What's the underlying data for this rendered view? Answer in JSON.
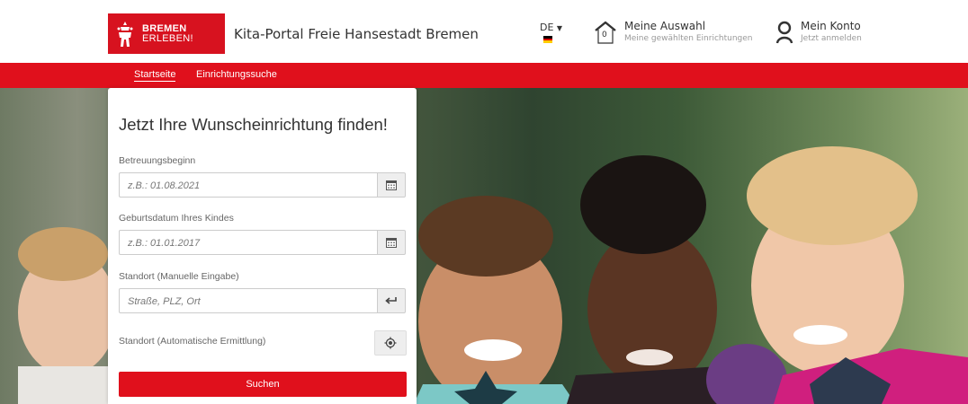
{
  "header": {
    "logo_line1": "BREMEN",
    "logo_line2": "ERLEBEN!",
    "portal_title": "Kita-Portal Freie Hansestadt Bremen",
    "language": "DE",
    "selection": {
      "title": "Meine Auswahl",
      "subtitle": "Meine gewählten Einrichtungen",
      "count": "0"
    },
    "account": {
      "title": "Mein Konto",
      "subtitle": "Jetzt anmelden"
    }
  },
  "nav": {
    "items": [
      {
        "label": "Startseite",
        "active": true
      },
      {
        "label": "Einrichtungssuche",
        "active": false
      }
    ]
  },
  "search": {
    "title": "Jetzt Ihre Wunscheinrichtung finden!",
    "start_label": "Betreuungsbeginn",
    "start_placeholder": "z.B.: 01.08.2021",
    "birth_label": "Geburtsdatum Ihres Kindes",
    "birth_placeholder": "z.B.: 01.01.2017",
    "location_label": "Standort (Manuelle Eingabe)",
    "location_placeholder": "Straße, PLZ, Ort",
    "auto_location_label": "Standort (Automatische Ermittlung)",
    "submit_label": "Suchen"
  },
  "colors": {
    "brand_red": "#e0101c",
    "logo_red": "#d7121f"
  },
  "icons": [
    "bremen-logo-icon",
    "house-icon",
    "user-icon",
    "calendar-icon",
    "enter-arrow-icon",
    "crosshair-icon",
    "caret-down-icon"
  ]
}
